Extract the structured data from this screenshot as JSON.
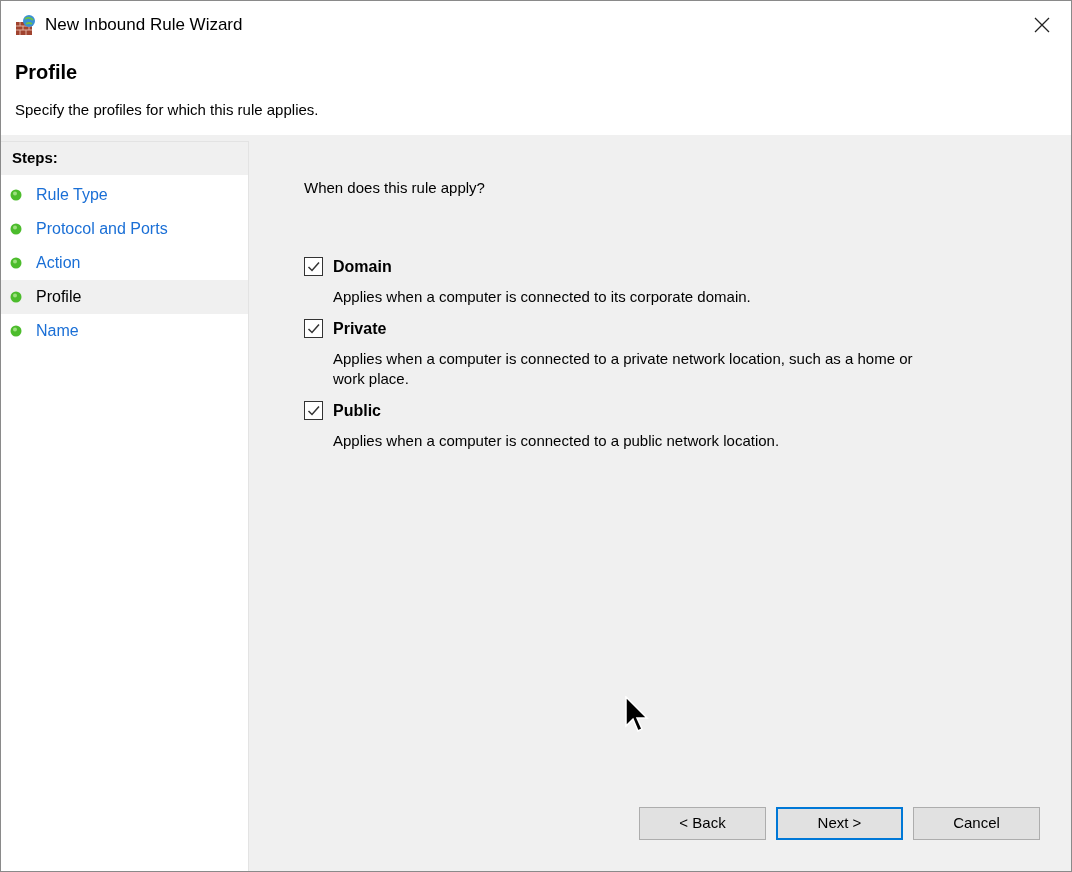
{
  "window": {
    "title": "New Inbound Rule Wizard"
  },
  "header": {
    "title": "Profile",
    "subtitle": "Specify the profiles for which this rule applies."
  },
  "steps": {
    "heading": "Steps:",
    "items": [
      {
        "label": "Rule Type",
        "selected": false
      },
      {
        "label": "Protocol and Ports",
        "selected": false
      },
      {
        "label": "Action",
        "selected": false
      },
      {
        "label": "Profile",
        "selected": true
      },
      {
        "label": "Name",
        "selected": false
      }
    ]
  },
  "question": "When does this rule apply?",
  "profiles": [
    {
      "label": "Domain",
      "checked": true,
      "description": "Applies when a computer is connected to its corporate domain."
    },
    {
      "label": "Private",
      "checked": true,
      "description": "Applies when a computer is connected to a private network location, such as a home or work place."
    },
    {
      "label": "Public",
      "checked": true,
      "description": "Applies when a computer is connected to a public network location."
    }
  ],
  "buttons": [
    {
      "label": "< Back",
      "default": false
    },
    {
      "label": "Next >",
      "default": true
    },
    {
      "label": "Cancel",
      "default": false
    }
  ]
}
